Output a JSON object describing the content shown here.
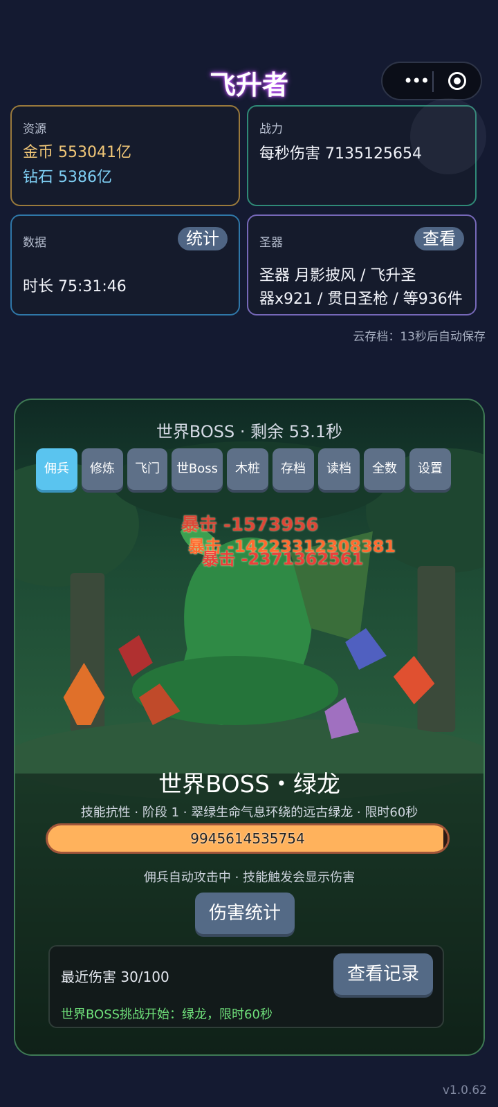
{
  "title": "飞升者",
  "cards": {
    "resources": {
      "label": "资源",
      "gold": "金币 553041亿",
      "diamond": "钻石 5386亿",
      "gold_color": "#f1c778",
      "diamond_color": "#7fd0f5"
    },
    "power": {
      "label": "战力",
      "dps": "每秒伤害 7135125654"
    },
    "data": {
      "label": "数据",
      "button": "统计",
      "duration": "时长 75:31:46"
    },
    "artifact": {
      "label": "圣器",
      "button": "查看",
      "line1": "圣器 月影披风 / 飞升圣",
      "line2": "器x921 / 贯日圣枪 / 等936件"
    }
  },
  "cloud_save": "云存档：13秒后自动保存",
  "boss": {
    "header": "世界BOSS · 剩余 53.1秒",
    "tabs": [
      "佣兵",
      "修炼",
      "飞门",
      "世Boss",
      "木桩",
      "存档",
      "读档",
      "全数",
      "设置"
    ],
    "active_tab": "佣兵",
    "damage_popups": [
      "暴击 -1573956",
      "暴击 -14223312308381",
      "暴击 -2371362561"
    ],
    "name": "世界BOSS・绿龙",
    "description": "技能抗性 · 阶段 1 · 翠绿生命气息环绕的远古绿龙 · 限时60秒",
    "hp_value": "9945614535754",
    "hp_fraction": 0.99,
    "auto_tip": "佣兵自动攻击中 · 技能触发会显示伤害",
    "damage_stats_button": "伤害统计",
    "recent_damage": "最近伤害 30/100",
    "view_log_button": "查看记录",
    "log_message": "世界BOSS挑战开始：绿龙，限时60秒"
  },
  "version": "v1.0.62"
}
